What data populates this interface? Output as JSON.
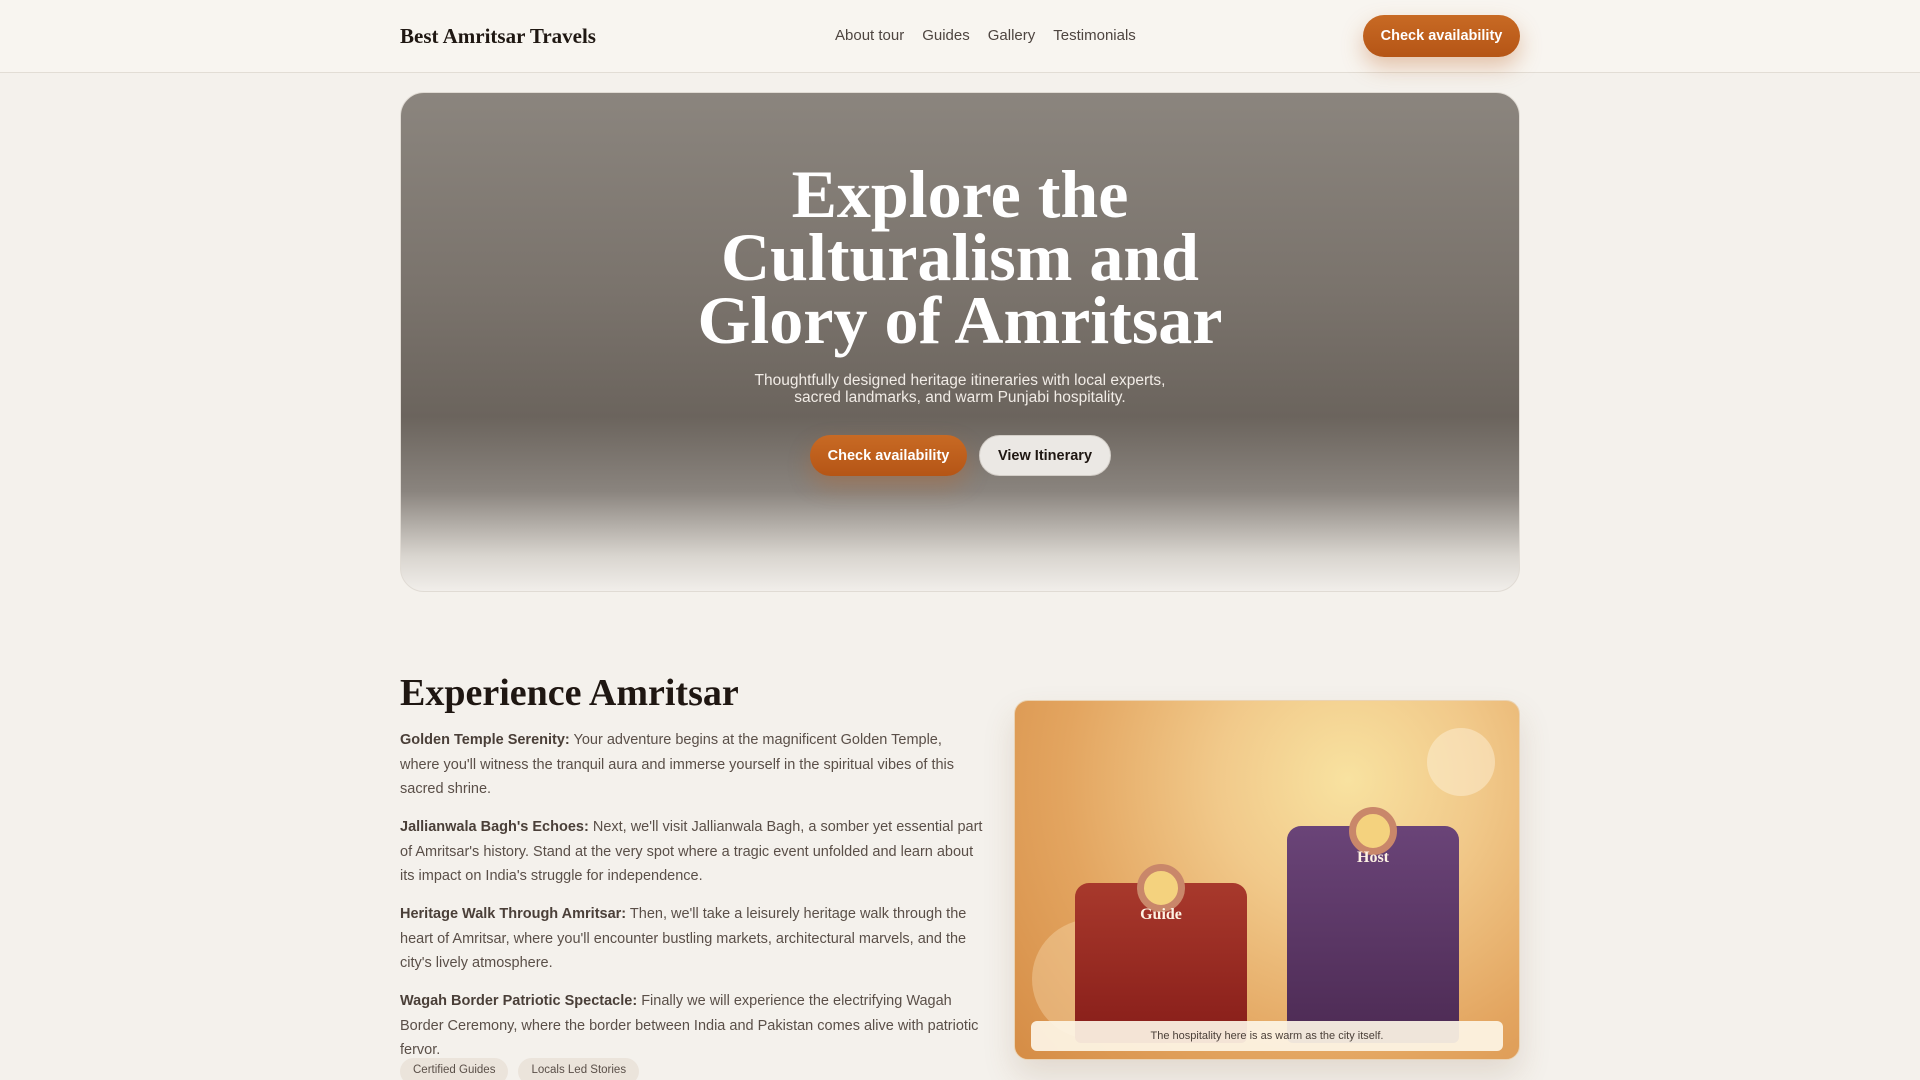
{
  "header": {
    "brand": "Best Amritsar Travels",
    "nav": [
      "About tour",
      "Guides",
      "Gallery",
      "Testimonials"
    ],
    "cta_label": "Check availability"
  },
  "hero": {
    "title_lines": [
      "Explore the",
      "Culturalism and",
      "Glory of Amritsar"
    ],
    "subtitle_lines": [
      "Thoughtfully designed heritage itineraries with local experts,",
      "sacred landmarks, and warm Punjabi hospitality."
    ],
    "primary_label": "Check availability",
    "secondary_label": "View Itinerary"
  },
  "experience": {
    "title": "Experience Amritsar",
    "paragraphs": [
      {
        "heading": "Golden Temple Serenity:",
        "text": " Your adventure begins at the magnificent Golden Temple, where you'll witness the tranquil aura and immerse yourself in the spiritual vibes of this sacred shrine."
      },
      {
        "heading": "Jallianwala Bagh's Echoes:",
        "text": " Next, we'll visit Jallianwala Bagh, a somber yet essential part of Amritsar's history. Stand at the very spot where a tragic event unfolded and learn about its impact on India's struggle for independence."
      },
      {
        "heading": "Heritage Walk Through Amritsar:",
        "text": " Then, we'll take a leisurely heritage walk through the heart of Amritsar, where you'll encounter bustling markets, architectural marvels, and the city's lively atmosphere."
      },
      {
        "heading": "Wagah Border Patriotic Spectacle:",
        "text": " Finally we will experience the electrifying Wagah Border Ceremony, where the border between India and Pakistan comes alive with patriotic fervor."
      }
    ],
    "chips": [
      "Certified Guides",
      "Locals Led Stories"
    ]
  },
  "illustration": {
    "guide_label": "Guide",
    "host_label": "Host",
    "caption": "The hospitality here is as warm as the city itself."
  },
  "colors": {
    "accent": "#c0621f",
    "background": "#f4f1ec",
    "guide_robe": "#9a2a22",
    "host_robe": "#5c3766"
  }
}
